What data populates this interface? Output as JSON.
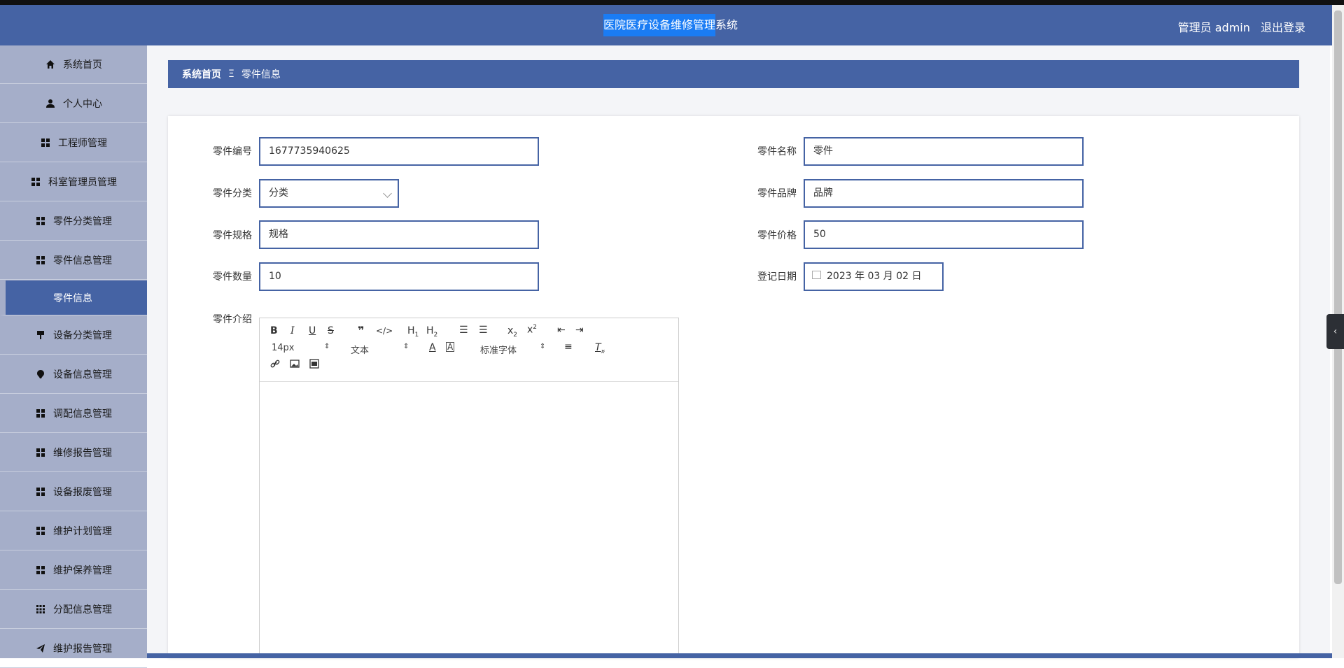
{
  "header": {
    "title_highlight": "医院医疗设备维修管理",
    "title_rest": "系统",
    "user_label": "管理员 admin",
    "logout_label": "退出登录"
  },
  "sidebar": {
    "items": [
      {
        "label": "系统首页",
        "icon": "home-icon"
      },
      {
        "label": "个人中心",
        "icon": "user-icon"
      },
      {
        "label": "工程师管理",
        "icon": "grid-icon"
      },
      {
        "label": "科室管理员管理",
        "icon": "grid-icon"
      },
      {
        "label": "零件分类管理",
        "icon": "grid-icon"
      },
      {
        "label": "零件信息管理",
        "icon": "grid-icon"
      },
      {
        "label": "零件信息",
        "icon": ""
      },
      {
        "label": "设备分类管理",
        "icon": "stamp-icon"
      },
      {
        "label": "设备信息管理",
        "icon": "bulb-icon"
      },
      {
        "label": "调配信息管理",
        "icon": "grid-icon"
      },
      {
        "label": "维修报告管理",
        "icon": "grid-icon"
      },
      {
        "label": "设备报废管理",
        "icon": "grid-icon"
      },
      {
        "label": "维护计划管理",
        "icon": "grid-icon"
      },
      {
        "label": "维护保养管理",
        "icon": "grid-icon"
      },
      {
        "label": "分配信息管理",
        "icon": "grid9-icon"
      },
      {
        "label": "维护报告管理",
        "icon": "send-icon"
      }
    ]
  },
  "breadcrumb": {
    "home": "系统首页",
    "separator": "Ξ",
    "current": "零件信息"
  },
  "form": {
    "part_no_label": "零件编号",
    "part_no_value": "1677735940625",
    "part_name_label": "零件名称",
    "part_name_value": "零件",
    "category_label": "零件分类",
    "category_value": "分类",
    "brand_label": "零件品牌",
    "brand_value": "品牌",
    "spec_label": "零件规格",
    "spec_value": "规格",
    "price_label": "零件价格",
    "price_value": "50",
    "qty_label": "零件数量",
    "qty_value": "10",
    "date_label": "登记日期",
    "date_value": "2023 年 03 月 02 日",
    "intro_label": "零件介绍"
  },
  "editor": {
    "font_size": "14px",
    "paragraph": "文本",
    "font_family": "标准字体"
  },
  "colors": {
    "primary": "#4563a4",
    "sidebar_bg": "#a5aec9",
    "title_highlight": "#1a7cf4"
  }
}
